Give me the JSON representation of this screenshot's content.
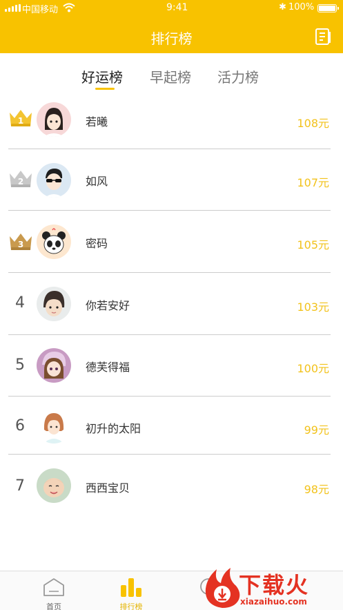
{
  "status_bar": {
    "carrier": "中国移动",
    "time": "9:41",
    "battery": "100%"
  },
  "header": {
    "title": "排行榜",
    "action_icon": "document-list-icon"
  },
  "tabs": [
    {
      "label": "好运榜",
      "active": true
    },
    {
      "label": "早起榜",
      "active": false
    },
    {
      "label": "活力榜",
      "active": false
    }
  ],
  "ranking": [
    {
      "rank": "1",
      "name": "若曦",
      "amount": "108元",
      "medal": "gold"
    },
    {
      "rank": "2",
      "name": "如风",
      "amount": "107元",
      "medal": "silver"
    },
    {
      "rank": "3",
      "name": "密码",
      "amount": "105元",
      "medal": "bronze"
    },
    {
      "rank": "4",
      "name": "你若安好",
      "amount": "103元",
      "medal": ""
    },
    {
      "rank": "5",
      "name": "德芙得福",
      "amount": "100元",
      "medal": ""
    },
    {
      "rank": "6",
      "name": "初升的太阳",
      "amount": "99元",
      "medal": ""
    },
    {
      "rank": "7",
      "name": "西西宝贝",
      "amount": "98元",
      "medal": ""
    }
  ],
  "bottom_nav": [
    {
      "label": "首页",
      "icon": "home-icon",
      "active": false
    },
    {
      "label": "排行榜",
      "icon": "bar-chart-icon",
      "active": true
    },
    {
      "label": "",
      "icon": "profile-icon",
      "active": false
    }
  ],
  "watermark": {
    "text": "下载火",
    "url": "xiazaihuo.com"
  },
  "colors": {
    "brand_yellow": "#f8c200",
    "amount_yellow": "#f2c21b",
    "gold": "#f3c431",
    "silver": "#c8c8c8",
    "bronze": "#c99a4e",
    "watermark_red": "#e43222"
  }
}
